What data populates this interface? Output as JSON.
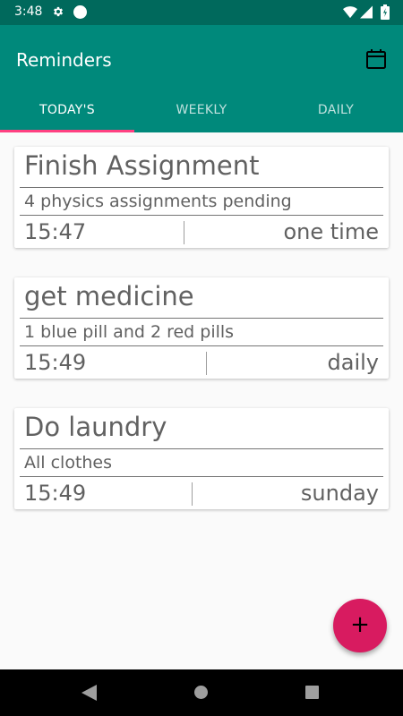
{
  "status_bar": {
    "time": "3:48",
    "icons": [
      "gear-icon",
      "notification-dot-icon",
      "wifi-icon",
      "signal-icon",
      "battery-icon"
    ]
  },
  "app_bar": {
    "title": "Reminders",
    "action_icon": "calendar-icon"
  },
  "tabs": [
    {
      "label": "TODAY'S",
      "selected": true
    },
    {
      "label": "WEEKLY",
      "selected": false
    },
    {
      "label": "DAILY",
      "selected": false
    }
  ],
  "reminders": [
    {
      "title": "Finish Assignment",
      "description": "4 physics assignments pending",
      "time": "15:47",
      "frequency": "one time"
    },
    {
      "title": "get medicine",
      "description": "1 blue pill and 2 red pills",
      "time": "15:49",
      "frequency": "daily"
    },
    {
      "title": "Do laundry",
      "description": "All clothes",
      "time": "15:49",
      "frequency": "sunday"
    }
  ],
  "fab": {
    "label": "+",
    "icon": "plus-icon"
  },
  "nav_bar": {
    "icons": [
      "back-icon",
      "home-icon",
      "recents-icon"
    ]
  },
  "colors": {
    "status_bar": "#00695c",
    "app_bar": "#00897b",
    "tab_indicator": "#ff4081",
    "fab": "#d81b60",
    "background": "#fafafa"
  }
}
